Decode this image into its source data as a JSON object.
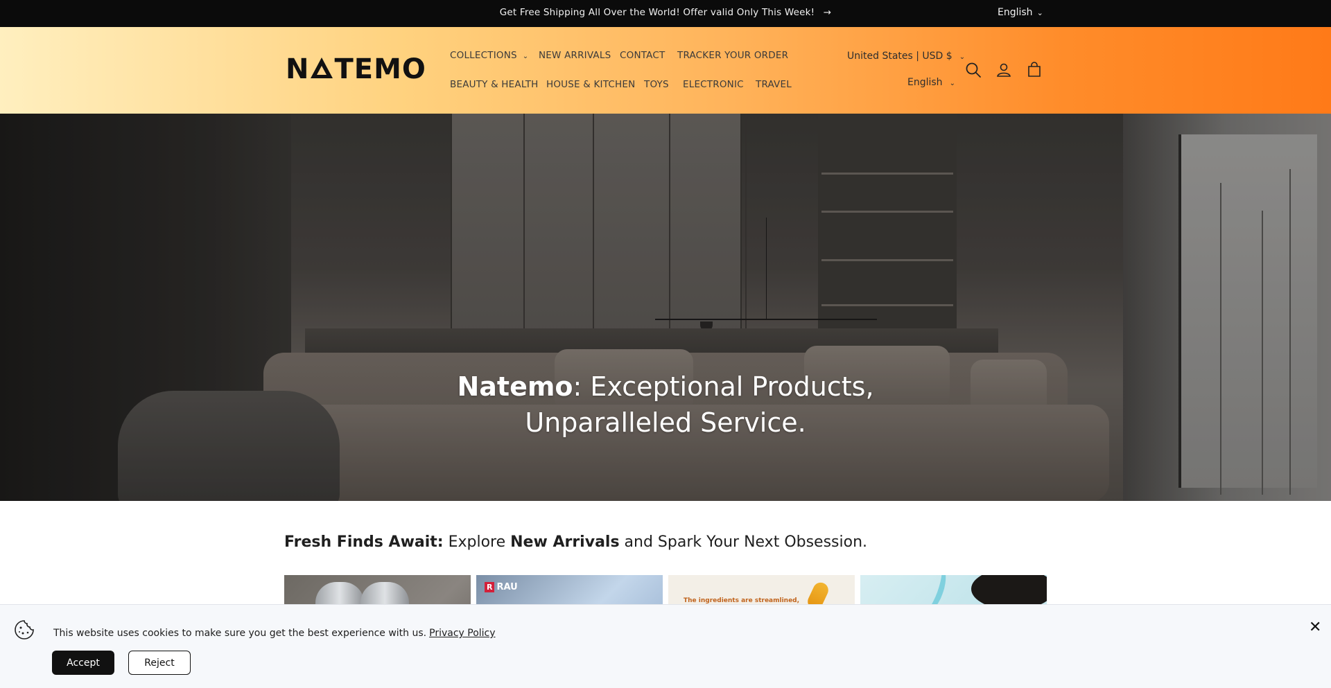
{
  "announcement": {
    "text": "Get Free Shipping All Over the World! Offer valid Only This Week!",
    "arrow": "→",
    "language": "English"
  },
  "header": {
    "logo_text": [
      "N",
      "TEMO"
    ],
    "nav": [
      {
        "label": "COLLECTIONS",
        "has_dropdown": true
      },
      {
        "label": "NEW ARRIVALS"
      },
      {
        "label": "CONTACT"
      },
      {
        "label": "TRACKER YOUR ORDER"
      },
      {
        "label": "BEAUTY & HEALTH"
      },
      {
        "label": "HOUSE & KITCHEN"
      },
      {
        "label": "TOYS"
      },
      {
        "label": "ELECTRONIC"
      },
      {
        "label": "TRAVEL"
      }
    ],
    "country_currency": "United States | USD $",
    "language": "English",
    "icons": [
      "search-icon",
      "account-icon",
      "cart-icon"
    ],
    "gradient_colors": [
      "#ffefbf",
      "#ff7a18"
    ]
  },
  "hero": {
    "title_bold": "Natemo",
    "title_rest_line1": ": Exceptional Products,",
    "title_line2": "Unparalleled Service."
  },
  "fresh": {
    "bold1": "Fresh Finds Await:",
    "text1": " Explore ",
    "bold2": "New Arrivals",
    "text2": " and Spark Your Next Obsession."
  },
  "cards": {
    "card2_brand": "RAU",
    "card2_badge": "R",
    "card3_text": "The ingredients are streamlined,"
  },
  "cookie": {
    "message": "This website uses cookies to make sure you get the best experience with us.",
    "policy_link": "Privacy Policy",
    "accept": "Accept",
    "reject": "Reject",
    "close": "✕"
  }
}
